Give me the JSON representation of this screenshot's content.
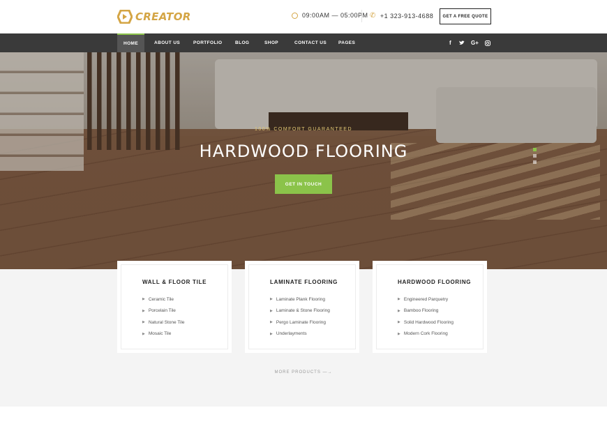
{
  "header": {
    "logo_text": "CREATOR",
    "hours": "09:00AM — 05:00PM",
    "phone": "+1 323-913-4688",
    "quote_button": "GET A FREE QUOTE"
  },
  "nav": {
    "items": [
      {
        "label": "HOME"
      },
      {
        "label": "ABOUT US"
      },
      {
        "label": "PORTFOLIO"
      },
      {
        "label": "BLOG"
      },
      {
        "label": "SHOP"
      },
      {
        "label": "CONTACT US"
      },
      {
        "label": "PAGES"
      }
    ],
    "active": "HOME",
    "social": [
      "f",
      "twitter-icon",
      "G+",
      "instagram-icon"
    ]
  },
  "hero": {
    "subtitle": "100% COMFORT GUARANTEED",
    "title": "HARDWOOD FLOORING",
    "button": "GET IN TOUCH",
    "slides": 3,
    "active_slide": 1
  },
  "cards": [
    {
      "title": "WALL & FLOOR TILE",
      "items": [
        "Ceramic Tile",
        "Porcelain Tile",
        "Natural Stone Tile",
        "Mosaic Tile"
      ]
    },
    {
      "title": "LAMINATE FLOORING",
      "items": [
        "Laminate Plank Flooring",
        "Laminate & Stone Flooring",
        "Pergo Laminate Flooring",
        "Underlayments"
      ]
    },
    {
      "title": "HARDWOOD FLOORING",
      "items": [
        "Engineered Parquetry",
        "Bamboo Flooring",
        "Solid Hardwood Flooring",
        "Modern Cork Flooring"
      ]
    }
  ],
  "more_products": "MORE PRODUCTS —→",
  "colors": {
    "accent_green": "#8bc34a",
    "logo_gold": "#d4a545",
    "nav_bg": "#3a3a3a"
  }
}
